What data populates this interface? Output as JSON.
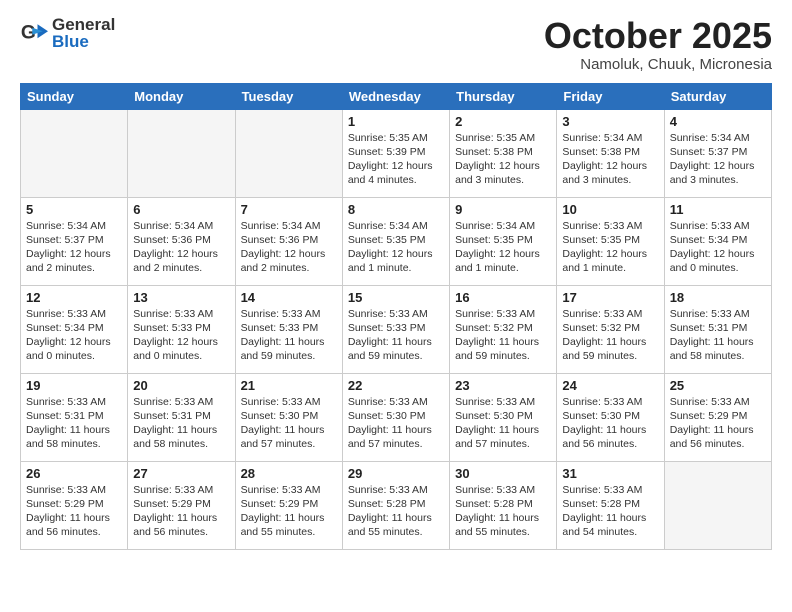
{
  "header": {
    "logo_general": "General",
    "logo_blue": "Blue",
    "month": "October 2025",
    "location": "Namoluk, Chuuk, Micronesia"
  },
  "days_of_week": [
    "Sunday",
    "Monday",
    "Tuesday",
    "Wednesday",
    "Thursday",
    "Friday",
    "Saturday"
  ],
  "weeks": [
    [
      {
        "day": "",
        "info": ""
      },
      {
        "day": "",
        "info": ""
      },
      {
        "day": "",
        "info": ""
      },
      {
        "day": "1",
        "info": "Sunrise: 5:35 AM\nSunset: 5:39 PM\nDaylight: 12 hours\nand 4 minutes."
      },
      {
        "day": "2",
        "info": "Sunrise: 5:35 AM\nSunset: 5:38 PM\nDaylight: 12 hours\nand 3 minutes."
      },
      {
        "day": "3",
        "info": "Sunrise: 5:34 AM\nSunset: 5:38 PM\nDaylight: 12 hours\nand 3 minutes."
      },
      {
        "day": "4",
        "info": "Sunrise: 5:34 AM\nSunset: 5:37 PM\nDaylight: 12 hours\nand 3 minutes."
      }
    ],
    [
      {
        "day": "5",
        "info": "Sunrise: 5:34 AM\nSunset: 5:37 PM\nDaylight: 12 hours\nand 2 minutes."
      },
      {
        "day": "6",
        "info": "Sunrise: 5:34 AM\nSunset: 5:36 PM\nDaylight: 12 hours\nand 2 minutes."
      },
      {
        "day": "7",
        "info": "Sunrise: 5:34 AM\nSunset: 5:36 PM\nDaylight: 12 hours\nand 2 minutes."
      },
      {
        "day": "8",
        "info": "Sunrise: 5:34 AM\nSunset: 5:35 PM\nDaylight: 12 hours\nand 1 minute."
      },
      {
        "day": "9",
        "info": "Sunrise: 5:34 AM\nSunset: 5:35 PM\nDaylight: 12 hours\nand 1 minute."
      },
      {
        "day": "10",
        "info": "Sunrise: 5:33 AM\nSunset: 5:35 PM\nDaylight: 12 hours\nand 1 minute."
      },
      {
        "day": "11",
        "info": "Sunrise: 5:33 AM\nSunset: 5:34 PM\nDaylight: 12 hours\nand 0 minutes."
      }
    ],
    [
      {
        "day": "12",
        "info": "Sunrise: 5:33 AM\nSunset: 5:34 PM\nDaylight: 12 hours\nand 0 minutes."
      },
      {
        "day": "13",
        "info": "Sunrise: 5:33 AM\nSunset: 5:33 PM\nDaylight: 12 hours\nand 0 minutes."
      },
      {
        "day": "14",
        "info": "Sunrise: 5:33 AM\nSunset: 5:33 PM\nDaylight: 11 hours\nand 59 minutes."
      },
      {
        "day": "15",
        "info": "Sunrise: 5:33 AM\nSunset: 5:33 PM\nDaylight: 11 hours\nand 59 minutes."
      },
      {
        "day": "16",
        "info": "Sunrise: 5:33 AM\nSunset: 5:32 PM\nDaylight: 11 hours\nand 59 minutes."
      },
      {
        "day": "17",
        "info": "Sunrise: 5:33 AM\nSunset: 5:32 PM\nDaylight: 11 hours\nand 59 minutes."
      },
      {
        "day": "18",
        "info": "Sunrise: 5:33 AM\nSunset: 5:31 PM\nDaylight: 11 hours\nand 58 minutes."
      }
    ],
    [
      {
        "day": "19",
        "info": "Sunrise: 5:33 AM\nSunset: 5:31 PM\nDaylight: 11 hours\nand 58 minutes."
      },
      {
        "day": "20",
        "info": "Sunrise: 5:33 AM\nSunset: 5:31 PM\nDaylight: 11 hours\nand 58 minutes."
      },
      {
        "day": "21",
        "info": "Sunrise: 5:33 AM\nSunset: 5:30 PM\nDaylight: 11 hours\nand 57 minutes."
      },
      {
        "day": "22",
        "info": "Sunrise: 5:33 AM\nSunset: 5:30 PM\nDaylight: 11 hours\nand 57 minutes."
      },
      {
        "day": "23",
        "info": "Sunrise: 5:33 AM\nSunset: 5:30 PM\nDaylight: 11 hours\nand 57 minutes."
      },
      {
        "day": "24",
        "info": "Sunrise: 5:33 AM\nSunset: 5:30 PM\nDaylight: 11 hours\nand 56 minutes."
      },
      {
        "day": "25",
        "info": "Sunrise: 5:33 AM\nSunset: 5:29 PM\nDaylight: 11 hours\nand 56 minutes."
      }
    ],
    [
      {
        "day": "26",
        "info": "Sunrise: 5:33 AM\nSunset: 5:29 PM\nDaylight: 11 hours\nand 56 minutes."
      },
      {
        "day": "27",
        "info": "Sunrise: 5:33 AM\nSunset: 5:29 PM\nDaylight: 11 hours\nand 56 minutes."
      },
      {
        "day": "28",
        "info": "Sunrise: 5:33 AM\nSunset: 5:29 PM\nDaylight: 11 hours\nand 55 minutes."
      },
      {
        "day": "29",
        "info": "Sunrise: 5:33 AM\nSunset: 5:28 PM\nDaylight: 11 hours\nand 55 minutes."
      },
      {
        "day": "30",
        "info": "Sunrise: 5:33 AM\nSunset: 5:28 PM\nDaylight: 11 hours\nand 55 minutes."
      },
      {
        "day": "31",
        "info": "Sunrise: 5:33 AM\nSunset: 5:28 PM\nDaylight: 11 hours\nand 54 minutes."
      },
      {
        "day": "",
        "info": ""
      }
    ]
  ]
}
